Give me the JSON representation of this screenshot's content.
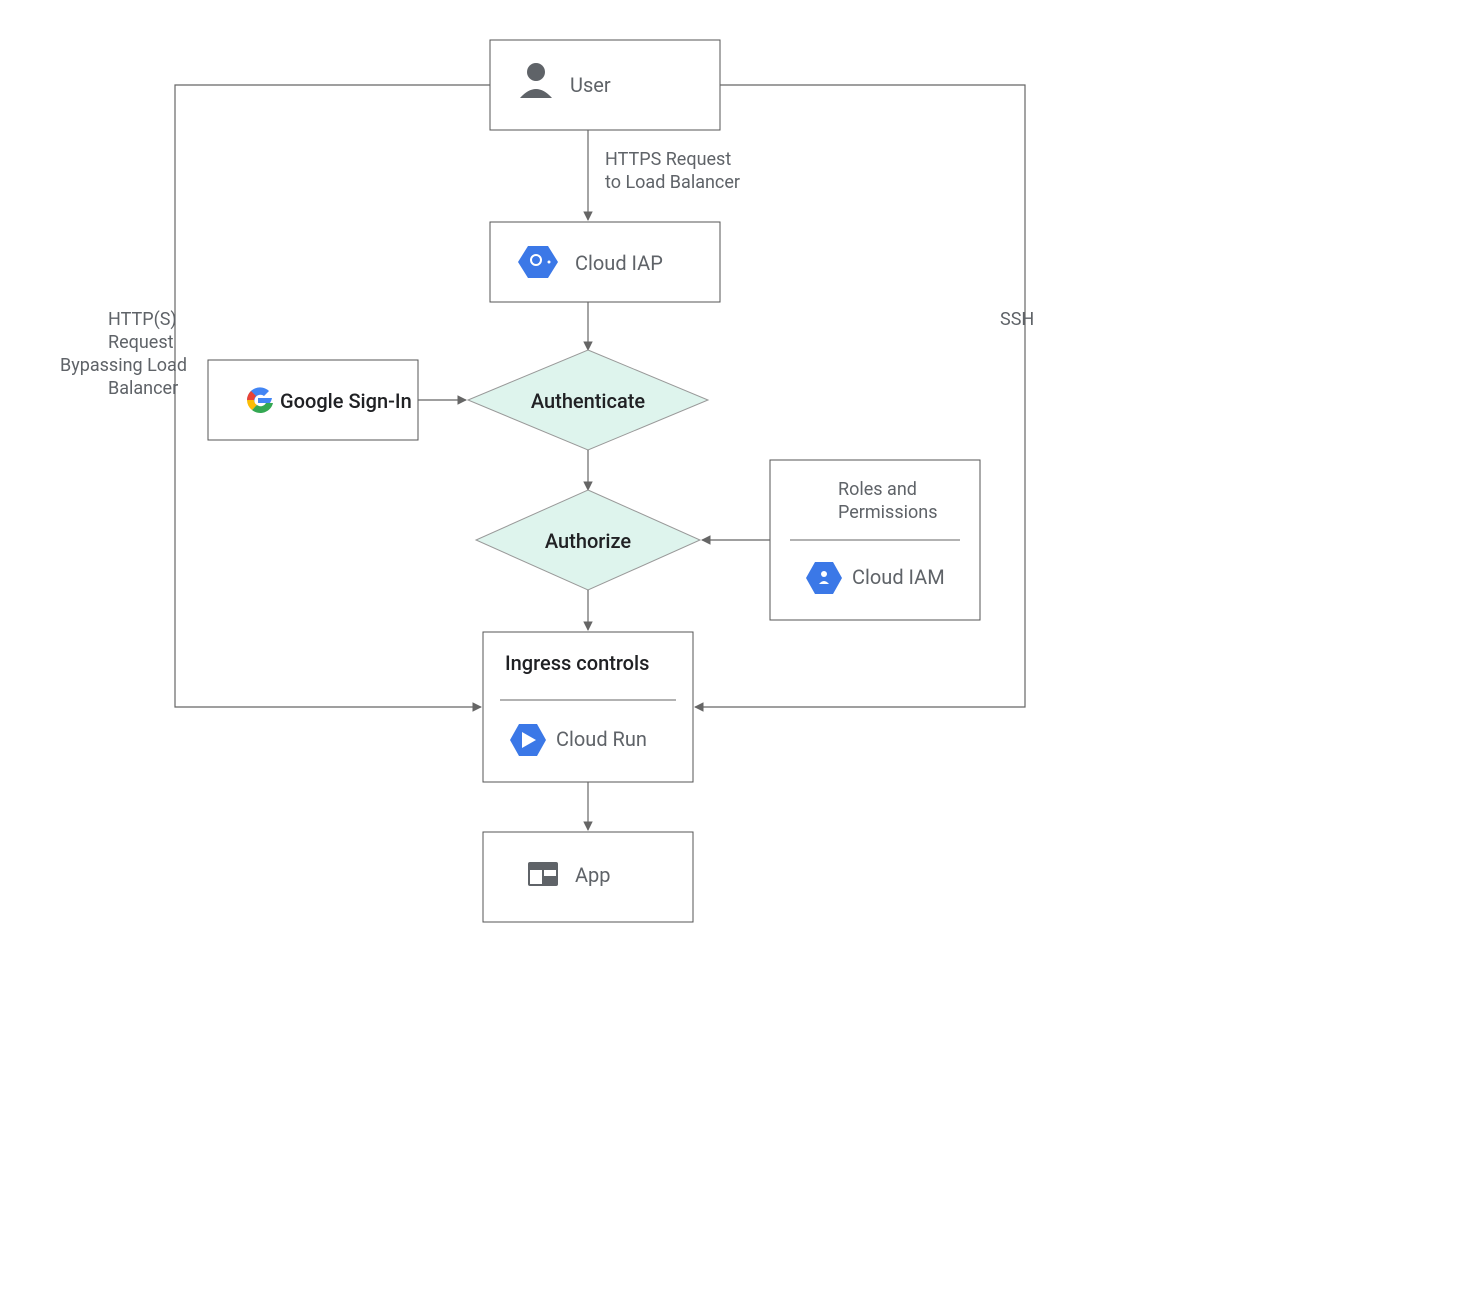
{
  "nodes": {
    "user": "User",
    "cloud_iap": "Cloud IAP",
    "google_signin": "Google Sign-In",
    "authenticate": "Authenticate",
    "authorize": "Authorize",
    "roles_title": "Roles and",
    "roles_title2": "Permissions",
    "cloud_iam": "Cloud IAM",
    "ingress_title": "Ingress controls",
    "cloud_run": "Cloud Run",
    "app": "App"
  },
  "edges": {
    "https1": "HTTPS Request",
    "https2": "to Load Balancer",
    "left1": "HTTP(S)",
    "left2": "Request",
    "left3": "Bypassing Load",
    "left4": "Balancer",
    "ssh": "SSH"
  }
}
